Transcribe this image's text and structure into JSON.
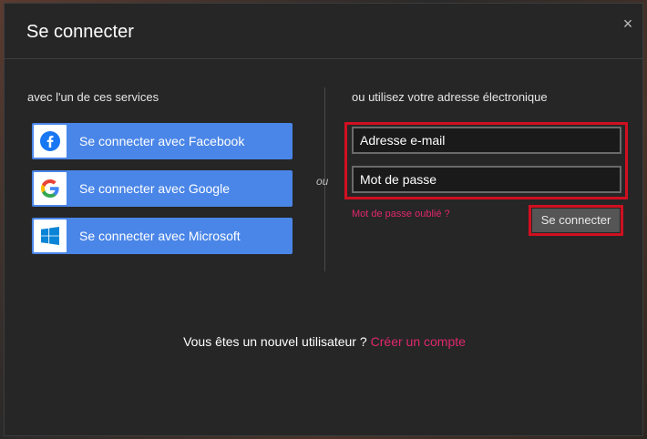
{
  "dialog": {
    "title": "Se connecter",
    "close_symbol": "×"
  },
  "left": {
    "heading": "avec l'un de ces services",
    "providers": [
      {
        "label": "Se connecter avec Facebook",
        "icon": "facebook-icon"
      },
      {
        "label": "Se connecter avec Google",
        "icon": "google-icon"
      },
      {
        "label": "Se connecter avec Microsoft",
        "icon": "microsoft-icon"
      }
    ]
  },
  "divider": {
    "label": "ou"
  },
  "right": {
    "heading": "ou utilisez votre adresse électronique",
    "email_placeholder": "Adresse e-mail",
    "password_placeholder": "Mot de passe",
    "forgot_label": "Mot de passe oublié ?",
    "submit_label": "Se connecter"
  },
  "footer": {
    "question": "Vous êtes un nouvel utilisateur ?",
    "create_link": "Créer un compte"
  },
  "colors": {
    "provider_button": "#4a86e8",
    "accent_link": "#e0286c",
    "highlight": "#d01020"
  }
}
